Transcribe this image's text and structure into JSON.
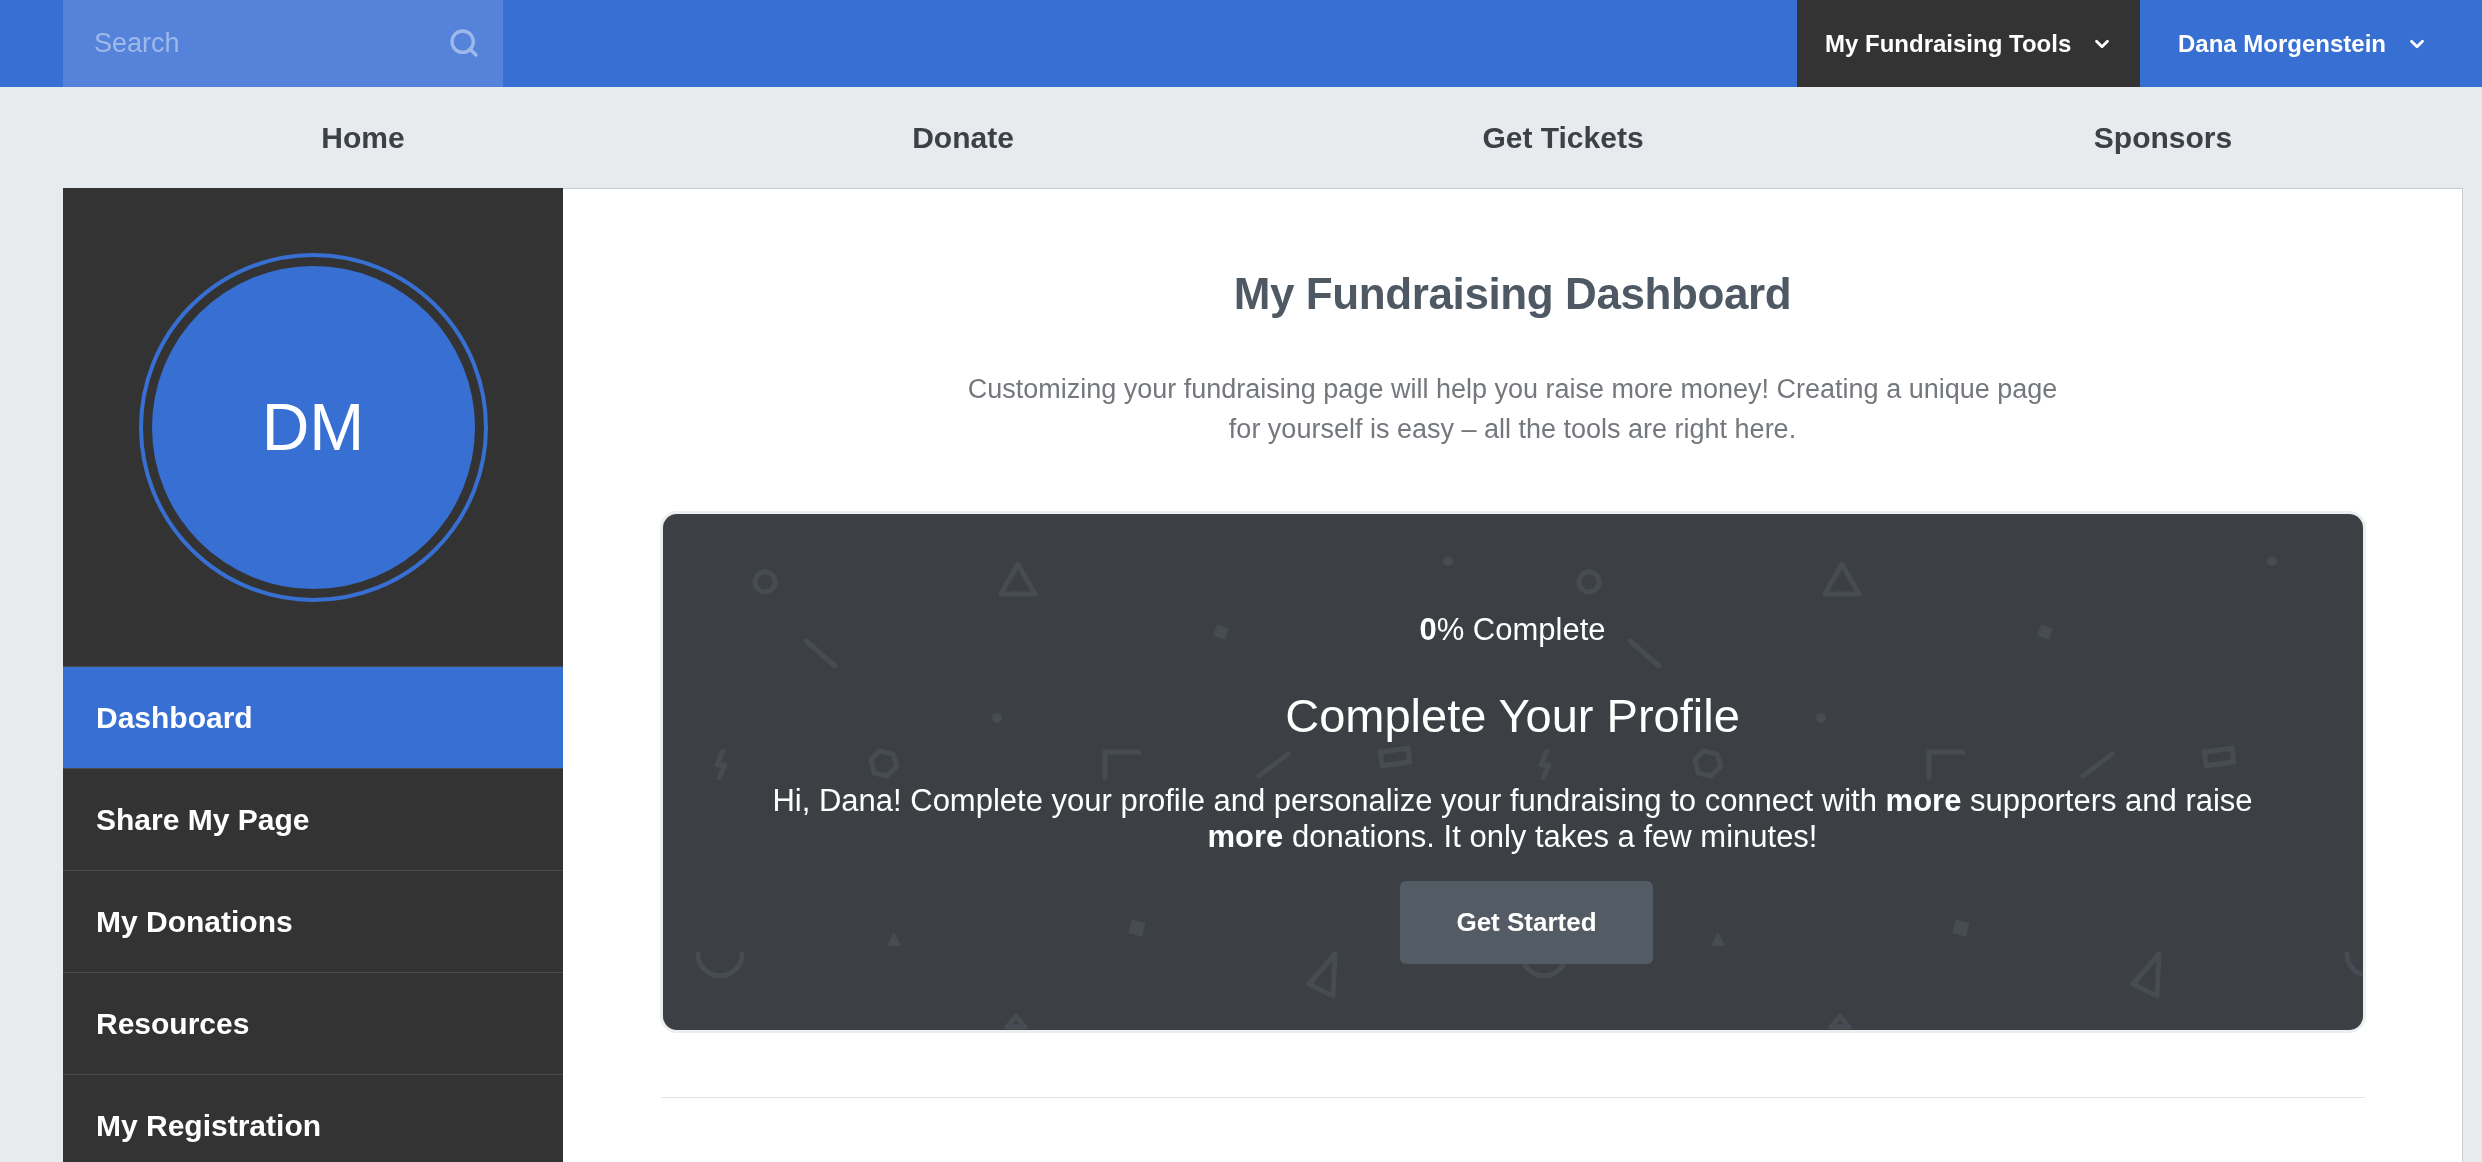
{
  "top_bar": {
    "search": {
      "placeholder": "Search"
    },
    "menus": [
      {
        "label": "My Fundraising Tools",
        "selected": true
      },
      {
        "label": "Dana Morgenstein",
        "selected": false
      }
    ]
  },
  "nav": [
    "Home",
    "Donate",
    "Get Tickets",
    "Sponsors"
  ],
  "sidebar": {
    "avatar": {
      "initials": "DM"
    },
    "items": [
      {
        "label": "Dashboard",
        "selected": true
      },
      {
        "label": "Share My Page",
        "selected": false
      },
      {
        "label": "My Donations",
        "selected": false
      },
      {
        "label": "Resources",
        "selected": false
      },
      {
        "label": "My Registration",
        "selected": false
      }
    ]
  },
  "main": {
    "title": "My Fundraising Dashboard",
    "intro": "Customizing your fundraising page will help you raise more money! Creating a unique page for yourself is easy – all the tools are right here.",
    "profile_card": {
      "progress": "**0**% Complete",
      "heading": "Complete Your Profile",
      "message": "Hi, Dana! Complete your profile and personalize your fundraising to connect with **more** supporters and raise **more** donations. It only takes a few minutes!",
      "button": "Get Started"
    }
  }
}
